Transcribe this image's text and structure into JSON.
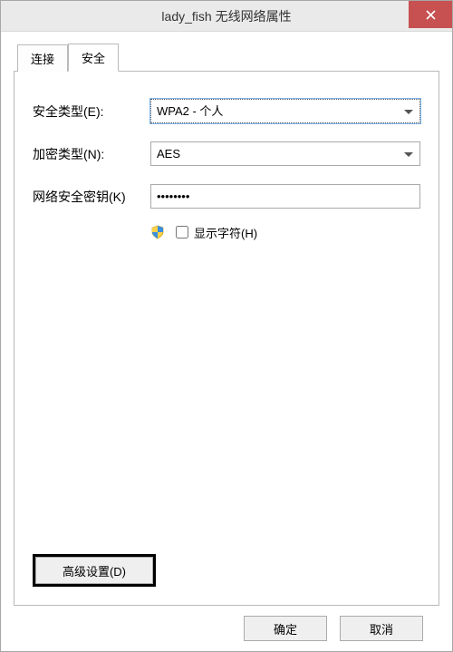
{
  "titlebar": {
    "title": "lady_fish 无线网络属性"
  },
  "tabs": {
    "connect": "连接",
    "security": "安全"
  },
  "form": {
    "security_type_label": "安全类型(E):",
    "security_type_value": "WPA2 - 个人",
    "encryption_type_label": "加密类型(N):",
    "encryption_type_value": "AES",
    "network_key_label": "网络安全密钥(K)",
    "network_key_value": "••••••••",
    "show_chars_label": "显示字符(H)"
  },
  "buttons": {
    "advanced": "高级设置(D)",
    "ok": "确定",
    "cancel": "取消"
  }
}
